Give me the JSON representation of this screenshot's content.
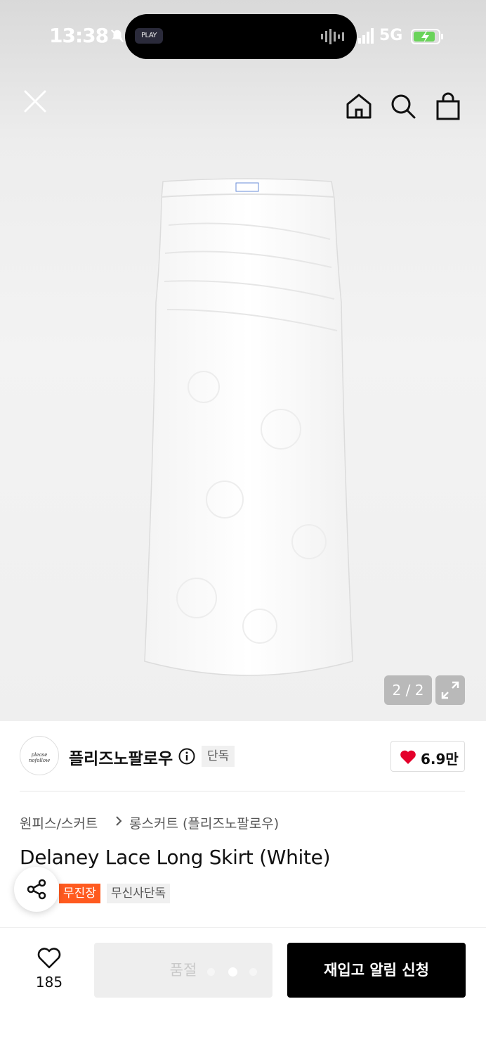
{
  "status_bar": {
    "time": "13:38",
    "island_label": "PLAY",
    "network": "5G"
  },
  "nav": {
    "icons": [
      "close-icon",
      "home-icon",
      "search-icon",
      "shopping-bag-icon"
    ]
  },
  "gallery": {
    "pager": "2 / 2"
  },
  "brand": {
    "logo_text": "please nofollow",
    "name": "플리즈노팔로우",
    "exclusive_tag": "단독",
    "likes": "6.9만"
  },
  "breadcrumb": {
    "category": "원피스/스커트",
    "subcategory": "롱스커트 (플리즈노팔로우)"
  },
  "product": {
    "title": "Delaney Lace Long Skirt (White)",
    "tags": [
      "무진장",
      "무신사단독"
    ]
  },
  "bottom_bar": {
    "wishlist_count": "185",
    "soldout_label": "품절",
    "restock_label": "재입고 알림 신청"
  },
  "colors": {
    "accent_orange": "#ff5a1f",
    "heart_red": "#e4002b",
    "primary_button": "#000000"
  }
}
